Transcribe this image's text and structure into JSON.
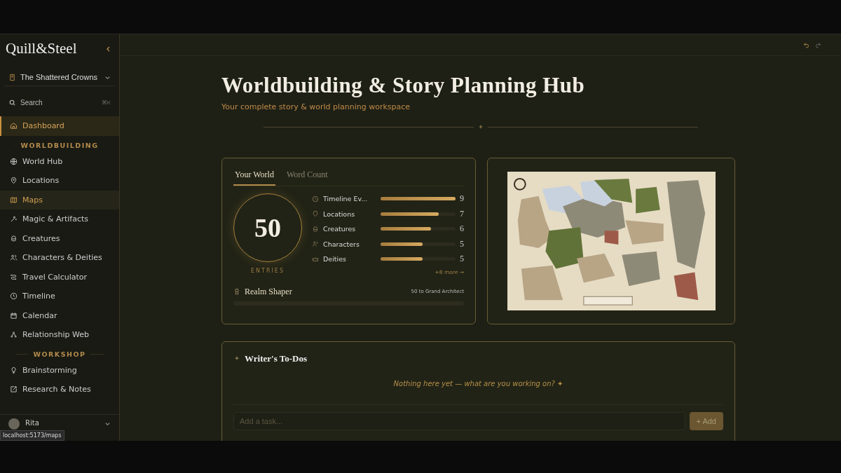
{
  "sidebar": {
    "logo": "Quill&Steel",
    "project": "The Shattered Crowns",
    "search": {
      "label": "Search",
      "shortcut": "⌘K"
    },
    "top_items": [
      {
        "label": "Dashboard",
        "selected": true
      }
    ],
    "sections": [
      {
        "title": "WORLDBUILDING",
        "items": [
          {
            "label": "World Hub",
            "selected": false,
            "hovered": false
          },
          {
            "label": "Locations",
            "selected": false,
            "hovered": false
          },
          {
            "label": "Maps",
            "selected": false,
            "hovered": true
          },
          {
            "label": "Magic & Artifacts",
            "selected": false,
            "hovered": false
          },
          {
            "label": "Creatures",
            "selected": false,
            "hovered": false
          },
          {
            "label": "Characters & Deities",
            "selected": false,
            "hovered": false
          },
          {
            "label": "Travel Calculator",
            "selected": false,
            "hovered": false
          },
          {
            "label": "Timeline",
            "selected": false,
            "hovered": false
          },
          {
            "label": "Calendar",
            "selected": false,
            "hovered": false
          },
          {
            "label": "Relationship Web",
            "selected": false,
            "hovered": false
          }
        ]
      },
      {
        "title": "WORKSHOP",
        "items": [
          {
            "label": "Brainstorming",
            "selected": false,
            "hovered": false
          },
          {
            "label": "Research & Notes",
            "selected": false,
            "hovered": false
          }
        ]
      }
    ],
    "user": {
      "name": "Rita"
    },
    "link_preview": "localhost:5173/maps"
  },
  "header": {
    "title": "Worldbuilding & Story Planning Hub",
    "subtitle": "Your complete story & world planning workspace"
  },
  "stats_card": {
    "tabs": [
      {
        "label": "Your World",
        "selected": true
      },
      {
        "label": "Word Count",
        "selected": false
      }
    ],
    "total": "50",
    "total_label": "ENTRIES",
    "rows": [
      {
        "label": "Timeline Ev...",
        "level": 1.0,
        "count": "9"
      },
      {
        "label": "Locations",
        "level": 0.78,
        "count": "7"
      },
      {
        "label": "Creatures",
        "level": 0.67,
        "count": "6"
      },
      {
        "label": "Characters",
        "level": 0.56,
        "count": "5"
      },
      {
        "label": "Deities",
        "level": 0.56,
        "count": "5"
      }
    ],
    "more": "+8 more →",
    "rank": {
      "title": "Realm Shaper",
      "next": "50 to Grand Architect"
    }
  },
  "todos": {
    "title": "Writer's To-Dos",
    "empty": "Nothing here yet — what are you working on? ✦",
    "placeholder": "Add a task...",
    "add_button": "+ Add"
  }
}
